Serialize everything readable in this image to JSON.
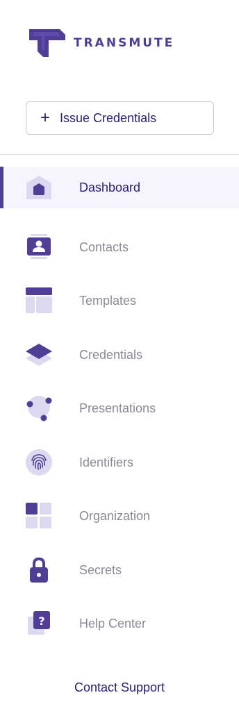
{
  "brand": {
    "name": "TRANSMUTE",
    "accent": "#4f3d96",
    "text_dark": "#2a2170"
  },
  "issue_button": {
    "plus": "+",
    "label": "Issue Credentials"
  },
  "nav": {
    "items": [
      {
        "label": "Dashboard",
        "icon": "home-icon",
        "active": true
      },
      {
        "label": "Contacts",
        "icon": "contact-card-icon"
      },
      {
        "label": "Templates",
        "icon": "template-icon"
      },
      {
        "label": "Credentials",
        "icon": "layers-icon"
      },
      {
        "label": "Presentations",
        "icon": "share-nodes-icon"
      },
      {
        "label": "Identifiers",
        "icon": "fingerprint-icon"
      },
      {
        "label": "Organization",
        "icon": "grid-icon"
      },
      {
        "label": "Secrets",
        "icon": "lock-icon"
      },
      {
        "label": "Help Center",
        "icon": "help-icon"
      }
    ]
  },
  "footer": {
    "support_label": "Contact Support"
  }
}
